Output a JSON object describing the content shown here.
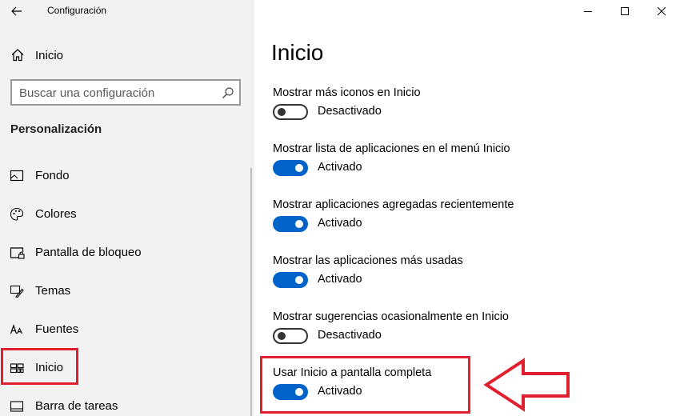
{
  "window": {
    "app_title": "Configuración",
    "back_icon": "back-arrow-icon",
    "controls": [
      "minimize-icon",
      "maximize-icon",
      "close-icon"
    ]
  },
  "sidebar": {
    "home": {
      "label": "Inicio",
      "icon": "home-icon"
    },
    "search": {
      "placeholder": "Buscar una configuración",
      "value": "",
      "icon": "search-icon"
    },
    "section_title": "Personalización",
    "items": [
      {
        "label": "Fondo",
        "icon": "picture-icon",
        "selected": false
      },
      {
        "label": "Colores",
        "icon": "palette-icon",
        "selected": false
      },
      {
        "label": "Pantalla de bloqueo",
        "icon": "lock-screen-icon",
        "selected": false
      },
      {
        "label": "Temas",
        "icon": "brush-icon",
        "selected": false
      },
      {
        "label": "Fuentes",
        "icon": "font-icon",
        "selected": false
      },
      {
        "label": "Inicio",
        "icon": "start-tiles-icon",
        "selected": true
      },
      {
        "label": "Barra de tareas",
        "icon": "taskbar-icon",
        "selected": false
      }
    ]
  },
  "main": {
    "title": "Inicio",
    "settings": [
      {
        "label": "Mostrar más iconos en Inicio",
        "on": false,
        "state": "Desactivado"
      },
      {
        "label": "Mostrar lista de aplicaciones en el menú Inicio",
        "on": true,
        "state": "Activado"
      },
      {
        "label": "Mostrar aplicaciones agregadas recientemente",
        "on": true,
        "state": "Activado"
      },
      {
        "label": "Mostrar las aplicaciones más usadas",
        "on": true,
        "state": "Activado"
      },
      {
        "label": "Mostrar sugerencias ocasionalmente en Inicio",
        "on": false,
        "state": "Desactivado"
      },
      {
        "label": "Usar Inicio a pantalla completa",
        "on": true,
        "state": "Activado"
      }
    ]
  },
  "colors": {
    "accent": "#0063c9",
    "annotation_red": "#e0202e",
    "sidebar_bg": "#f2f2f2"
  }
}
